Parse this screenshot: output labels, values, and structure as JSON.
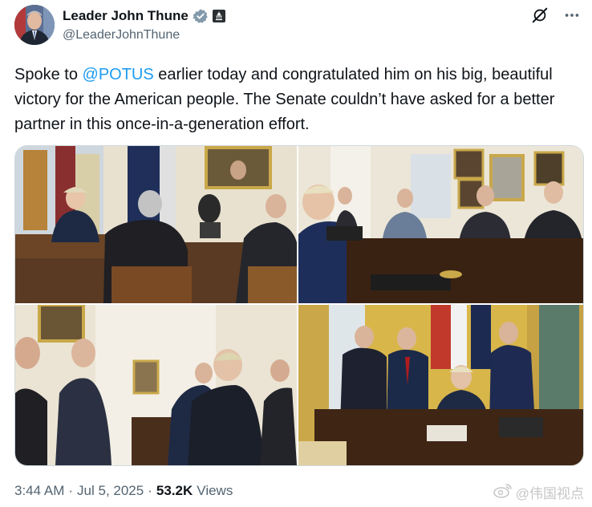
{
  "author": {
    "display_name": "Leader John Thune",
    "handle": "@LeaderJohnThune",
    "verified_icon": "verified-badge-icon",
    "affiliation_icon": "government-capitol-icon"
  },
  "actions": {
    "grok_icon": "grok-icon",
    "more_icon": "more-dots-icon",
    "more_label": "•••"
  },
  "tweet": {
    "text_before": "Spoke to ",
    "mention": "@POTUS",
    "text_after": " earlier today and congratulated him on his big, beautiful victory for the American people. The Senate couldn’t have asked for a better partner in this once-in-a-generation effort."
  },
  "photos": [
    {
      "scene": "oval-office-meeting-wide"
    },
    {
      "scene": "oval-office-meeting-table"
    },
    {
      "scene": "oval-office-standing-group"
    },
    {
      "scene": "resolute-desk-group-photo"
    }
  ],
  "meta": {
    "time": "3:44 AM",
    "separator": "·",
    "date": "Jul 5, 2025",
    "views_count": "53.2K",
    "views_label": "Views"
  },
  "watermark": {
    "text": "@伟国视点",
    "icon": "weibo-icon"
  },
  "colors": {
    "accent": "#1d9bf0",
    "text": "#0f1419",
    "muted": "#536471"
  }
}
